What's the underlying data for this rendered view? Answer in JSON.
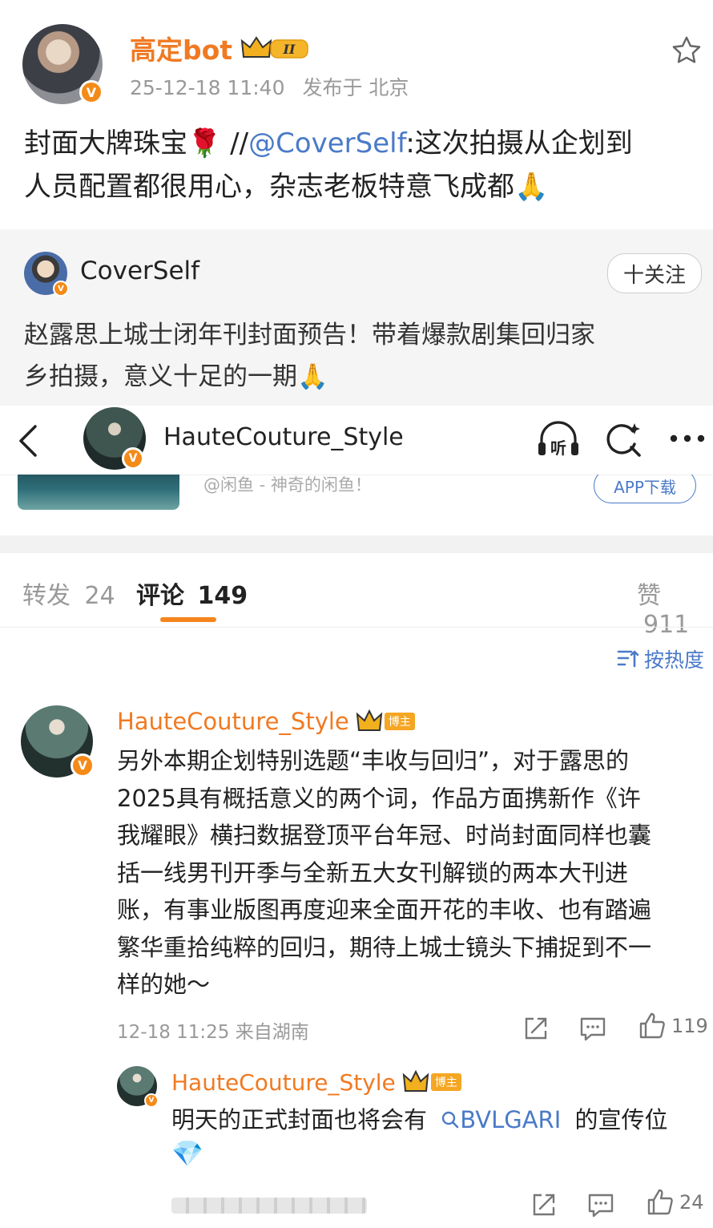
{
  "post": {
    "author": "高定bot",
    "level_badge": "II",
    "timestamp": "25-12-18 11:40",
    "location": "发布于 北京",
    "text_prefix": "封面大牌珠宝",
    "rose_emoji": "🌹",
    "separator": " //",
    "mention": "@CoverSelf",
    "text_line1_rest": ":这次拍摄从企划到",
    "text_line2": "人员配置都很用心，杂志老板特意飞成都",
    "hands_emoji": "🙏"
  },
  "repost": {
    "author": "CoverSelf",
    "follow_label": "十关注",
    "text_line1": "赵露思上城士闭年刊封面预告！带着爆款剧集回归家",
    "text_line2": "乡拍摄，意义十足的一期",
    "hands_emoji": "🙏"
  },
  "navbar": {
    "title": "HauteCouture_Style",
    "listen_label": "听"
  },
  "ad": {
    "text": "@闲鱼 - 神奇的闲鱼！",
    "button": "APP下载"
  },
  "tabs": {
    "repost_label": "转发",
    "repost_count": "24",
    "comment_label": "评论",
    "comment_count": "149",
    "like_label": "赞",
    "like_count": "911"
  },
  "sort": {
    "label": "按热度"
  },
  "comments": [
    {
      "author": "HauteCouture_Style",
      "badge": "博主",
      "lines": [
        "另外本期企划特别选题“丰收与回归”，对于露思的",
        "2025具有概括意义的两个词，作品方面携新作《许",
        "我耀眼》横扫数据登顶平台年冠、时尚封面同样也囊",
        "括一线男刊开季与全新五大女刊解锁的两本大刊进",
        "账，有事业版图再度迎来全面开花的丰收、也有踏遍",
        "繁华重拾纯粹的回归，期待上城士镜头下捕捉到不一",
        "样的她～"
      ],
      "meta": "12-18 11:25 来自湖南",
      "likes": "119"
    },
    {
      "author": "HauteCouture_Style",
      "badge": "博主",
      "text_before": "明天的正式封面也将会有",
      "search_link": "BVLGARI",
      "text_after": "的宣传位",
      "diamond_emoji": "💎",
      "likes": "24"
    }
  ],
  "colors": {
    "accent_orange": "#f07a22",
    "link_blue": "#4a7ac8",
    "verified_badge": "#f48a18"
  }
}
